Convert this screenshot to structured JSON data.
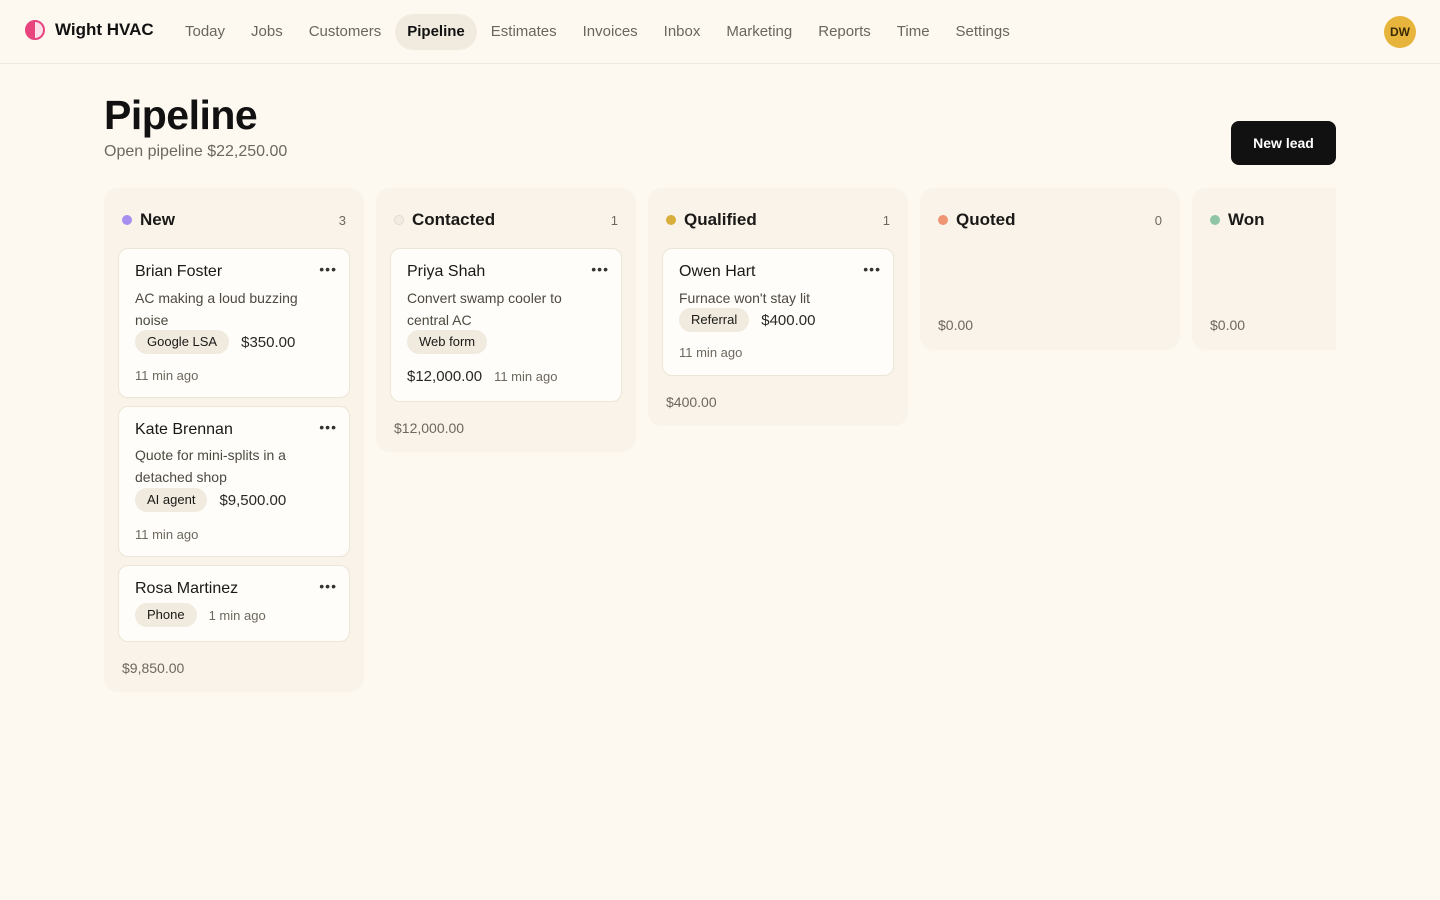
{
  "app": {
    "name": "Wight HVAC",
    "user_initials": "DW"
  },
  "nav": [
    {
      "label": "Today"
    },
    {
      "label": "Jobs"
    },
    {
      "label": "Customers"
    },
    {
      "label": "Pipeline",
      "active": true
    },
    {
      "label": "Estimates"
    },
    {
      "label": "Invoices"
    },
    {
      "label": "Inbox"
    },
    {
      "label": "Marketing"
    },
    {
      "label": "Reports"
    },
    {
      "label": "Time"
    },
    {
      "label": "Settings"
    }
  ],
  "page": {
    "title": "Pipeline",
    "subtitle": "Open pipeline $22,250.00",
    "new_lead_label": "New lead"
  },
  "columns": [
    {
      "title": "New",
      "count": "3",
      "total": "$9,850.00",
      "dot_color": "#a58ef0",
      "cards": [
        {
          "name": "Brian Foster",
          "menu": "•••",
          "description": "AC making a loud buzzing noise",
          "source": "Google LSA",
          "amount": "$350.00",
          "ago": "11 min ago"
        },
        {
          "name": "Kate Brennan",
          "menu": "•••",
          "description": "Quote for mini-splits in a detached shop",
          "source": "AI agent",
          "amount": "$9,500.00",
          "ago": "11 min ago"
        },
        {
          "name": "Rosa Martinez",
          "menu": "•••",
          "source": "Phone",
          "ago": "1 min ago"
        }
      ]
    },
    {
      "title": "Contacted",
      "count": "1",
      "total": "$12,000.00",
      "dot_color": "#f3ece2",
      "cards": [
        {
          "name": "Priya Shah",
          "menu": "•••",
          "description": "Convert swamp cooler to central AC",
          "source": "Web form",
          "amount": "$12,000.00",
          "ago": "11 min ago"
        }
      ]
    },
    {
      "title": "Qualified",
      "count": "1",
      "total": "$400.00",
      "dot_color": "#d9ae3a",
      "cards": [
        {
          "name": "Owen Hart",
          "menu": "•••",
          "description": "Furnace won't stay lit",
          "source": "Referral",
          "amount": "$400.00",
          "ago": "11 min ago"
        }
      ]
    },
    {
      "title": "Quoted",
      "count": "0",
      "total": "$0.00",
      "dot_color": "#ef9574",
      "cards": []
    },
    {
      "title": "Won",
      "total": "$0.00",
      "dot_color": "#8fc4a5",
      "cards": []
    }
  ]
}
